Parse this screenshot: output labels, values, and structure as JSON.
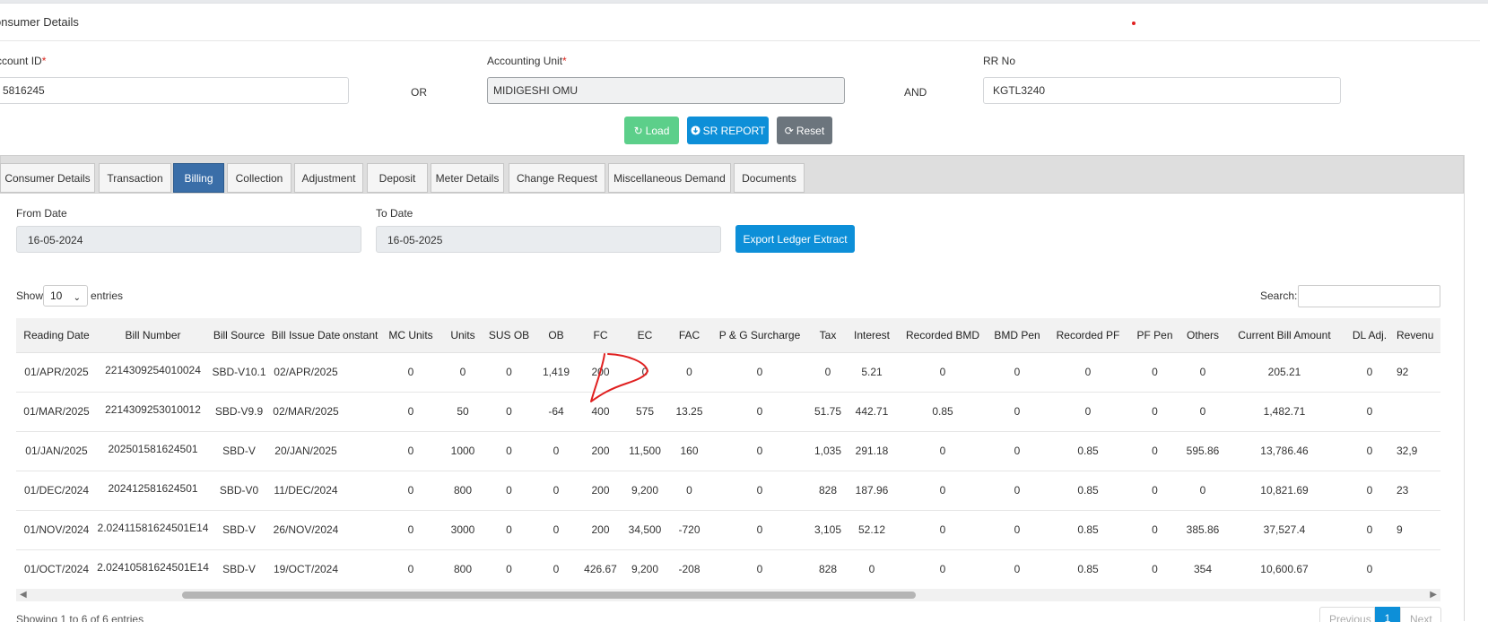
{
  "card": {
    "title": "onsumer Details"
  },
  "form": {
    "account_id": {
      "label": "ccount ID",
      "value": "5816245"
    },
    "or_label": "OR",
    "accounting_unit": {
      "label": "Accounting Unit",
      "value": "MIDIGESHI OMU"
    },
    "and_label": "AND",
    "rr_no": {
      "label": "RR No",
      "value": "KGTL3240"
    },
    "required_mark": "*"
  },
  "buttons": {
    "load": "Load",
    "sr_report": "SR REPORT",
    "reset": "Reset",
    "export": "Export Ledger Extract"
  },
  "tabs": [
    {
      "label": "Consumer Details",
      "active": false
    },
    {
      "label": "Transaction",
      "active": false
    },
    {
      "label": "Billing",
      "active": true
    },
    {
      "label": "Collection",
      "active": false
    },
    {
      "label": "Adjustment",
      "active": false
    },
    {
      "label": "Deposit",
      "active": false
    },
    {
      "label": "Meter Details",
      "active": false
    },
    {
      "label": "Change Request",
      "active": false
    },
    {
      "label": "Miscellaneous Demand",
      "active": false
    },
    {
      "label": "Documents",
      "active": false
    }
  ],
  "filters": {
    "from_date": {
      "label": "From Date",
      "value": "16-05-2024"
    },
    "to_date": {
      "label": "To Date",
      "value": "16-05-2025"
    }
  },
  "table_controls": {
    "show": "Show",
    "entries_value": "10",
    "entries": "entries",
    "search": "Search:"
  },
  "table": {
    "columns": [
      "Reading Date",
      "Bill Number",
      "Bill Source",
      "Bill Issue Date",
      "onstant",
      "MC Units",
      "Units",
      "SUS OB",
      "OB",
      "FC",
      "EC",
      "FAC",
      "P & G Surcharge",
      "Tax",
      "Interest",
      "Recorded BMD",
      "BMD Pen",
      "Recorded PF",
      "PF Pen",
      "Others",
      "Current Bill Amount",
      "DL Adj.",
      "Revenu"
    ],
    "rows": [
      [
        "01/APR/2025",
        "2214309254010024",
        "SBD-V10.1",
        "02/APR/2025",
        "",
        "0",
        "0",
        "0",
        "1,419",
        "200",
        "0",
        "0",
        "0",
        "0",
        "5.21",
        "0",
        "0",
        "0",
        "0",
        "0",
        "205.21",
        "0",
        "92"
      ],
      [
        "01/MAR/2025",
        "2214309253010012",
        "SBD-V9.9",
        "02/MAR/2025",
        "",
        "0",
        "50",
        "0",
        "-64",
        "400",
        "575",
        "13.25",
        "0",
        "51.75",
        "442.71",
        "0.85",
        "0",
        "0",
        "0",
        "0",
        "1,482.71",
        "0",
        ""
      ],
      [
        "01/JAN/2025",
        "202501581624501",
        "SBD-V",
        "20/JAN/2025",
        "",
        "0",
        "1000",
        "0",
        "0",
        "200",
        "11,500",
        "160",
        "0",
        "1,035",
        "291.18",
        "0",
        "0",
        "0.85",
        "0",
        "595.86",
        "13,786.46",
        "0",
        "32,9"
      ],
      [
        "01/DEC/2024",
        "202412581624501",
        "SBD-V0",
        "11/DEC/2024",
        "",
        "0",
        "800",
        "0",
        "0",
        "200",
        "9,200",
        "0",
        "0",
        "828",
        "187.96",
        "0",
        "0",
        "0.85",
        "0",
        "0",
        "10,821.69",
        "0",
        "23"
      ],
      [
        "01/NOV/2024",
        "2.02411581624501E14",
        "SBD-V",
        "26/NOV/2024",
        "",
        "0",
        "3000",
        "0",
        "0",
        "200",
        "34,500",
        "-720",
        "0",
        "3,105",
        "52.12",
        "0",
        "0",
        "0.85",
        "0",
        "385.86",
        "37,527.4",
        "0",
        "9"
      ],
      [
        "01/OCT/2024",
        "2.02410581624501E14",
        "SBD-V",
        "19/OCT/2024",
        "",
        "0",
        "800",
        "0",
        "0",
        "426.67",
        "9,200",
        "-208",
        "0",
        "828",
        "0",
        "0",
        "0",
        "0.85",
        "0",
        "354",
        "10,600.67",
        "0",
        ""
      ]
    ]
  },
  "footer": {
    "info": "Showing 1 to 6 of 6 entries",
    "previous": "Previous",
    "page": "1",
    "next": "Next"
  },
  "colors": {
    "active_tab": "#3a6ea8",
    "primary": "#0d8fd8",
    "success": "#5ccf8a",
    "secondary": "#6c757d",
    "annotation": "#e02020"
  }
}
